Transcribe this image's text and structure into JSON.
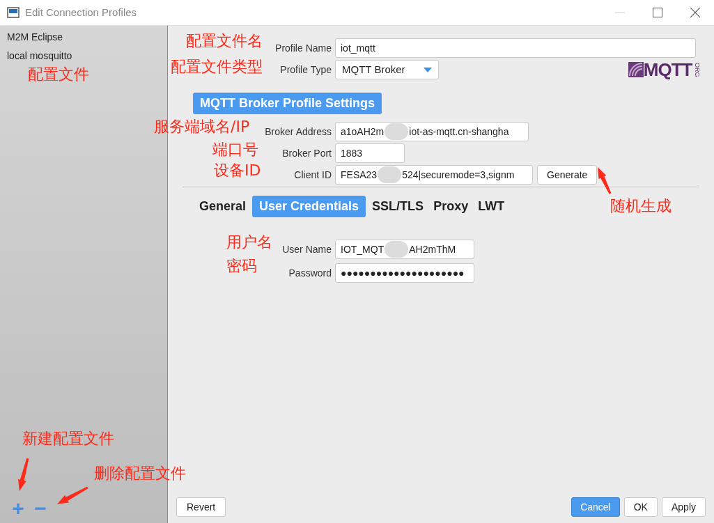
{
  "window": {
    "title": "Edit Connection Profiles"
  },
  "sidebar": {
    "items": [
      {
        "label": "M2M Eclipse"
      },
      {
        "label": "local mosquitto"
      }
    ],
    "add_button": "+",
    "remove_button": "−"
  },
  "profile": {
    "name_label": "Profile Name",
    "name_value": "iot_mqtt",
    "type_label": "Profile Type",
    "type_value": "MQTT Broker",
    "logo": "MQTT",
    "logo_small": "ORG"
  },
  "section_button": "MQTT Broker Profile Settings",
  "broker": {
    "address_label": "Broker Address",
    "address_parts": [
      "a1oAH2m",
      "iot-as-mqtt.cn-shangha"
    ],
    "port_label": "Broker Port",
    "port_value": "1883",
    "client_label": "Client ID",
    "client_parts": [
      "FESA23",
      "524|securemode=3,signm"
    ],
    "generate": "Generate"
  },
  "tabs": [
    {
      "label": "General",
      "selected": false
    },
    {
      "label": "User Credentials",
      "selected": true
    },
    {
      "label": "SSL/TLS",
      "selected": false
    },
    {
      "label": "Proxy",
      "selected": false
    },
    {
      "label": "LWT",
      "selected": false
    }
  ],
  "credentials": {
    "user_label": "User Name",
    "user_parts": [
      "IOT_MQT",
      "AH2mThM"
    ],
    "password_label": "Password",
    "password_value": "●●●●●●●●●●●●●●●●●●●●●"
  },
  "footer": {
    "revert": "Revert",
    "cancel": "Cancel",
    "ok": "OK",
    "apply": "Apply"
  },
  "annotations": [
    {
      "text": "配置文件名"
    },
    {
      "text": "配置文件类型"
    },
    {
      "text": "配置文件"
    },
    {
      "text": "服务端域名/IP"
    },
    {
      "text": "端口号"
    },
    {
      "text": "设备ID"
    },
    {
      "text": "随机生成"
    },
    {
      "text": "用户名"
    },
    {
      "text": "密码"
    },
    {
      "text": "新建配置文件"
    },
    {
      "text": "删除配置文件"
    }
  ]
}
